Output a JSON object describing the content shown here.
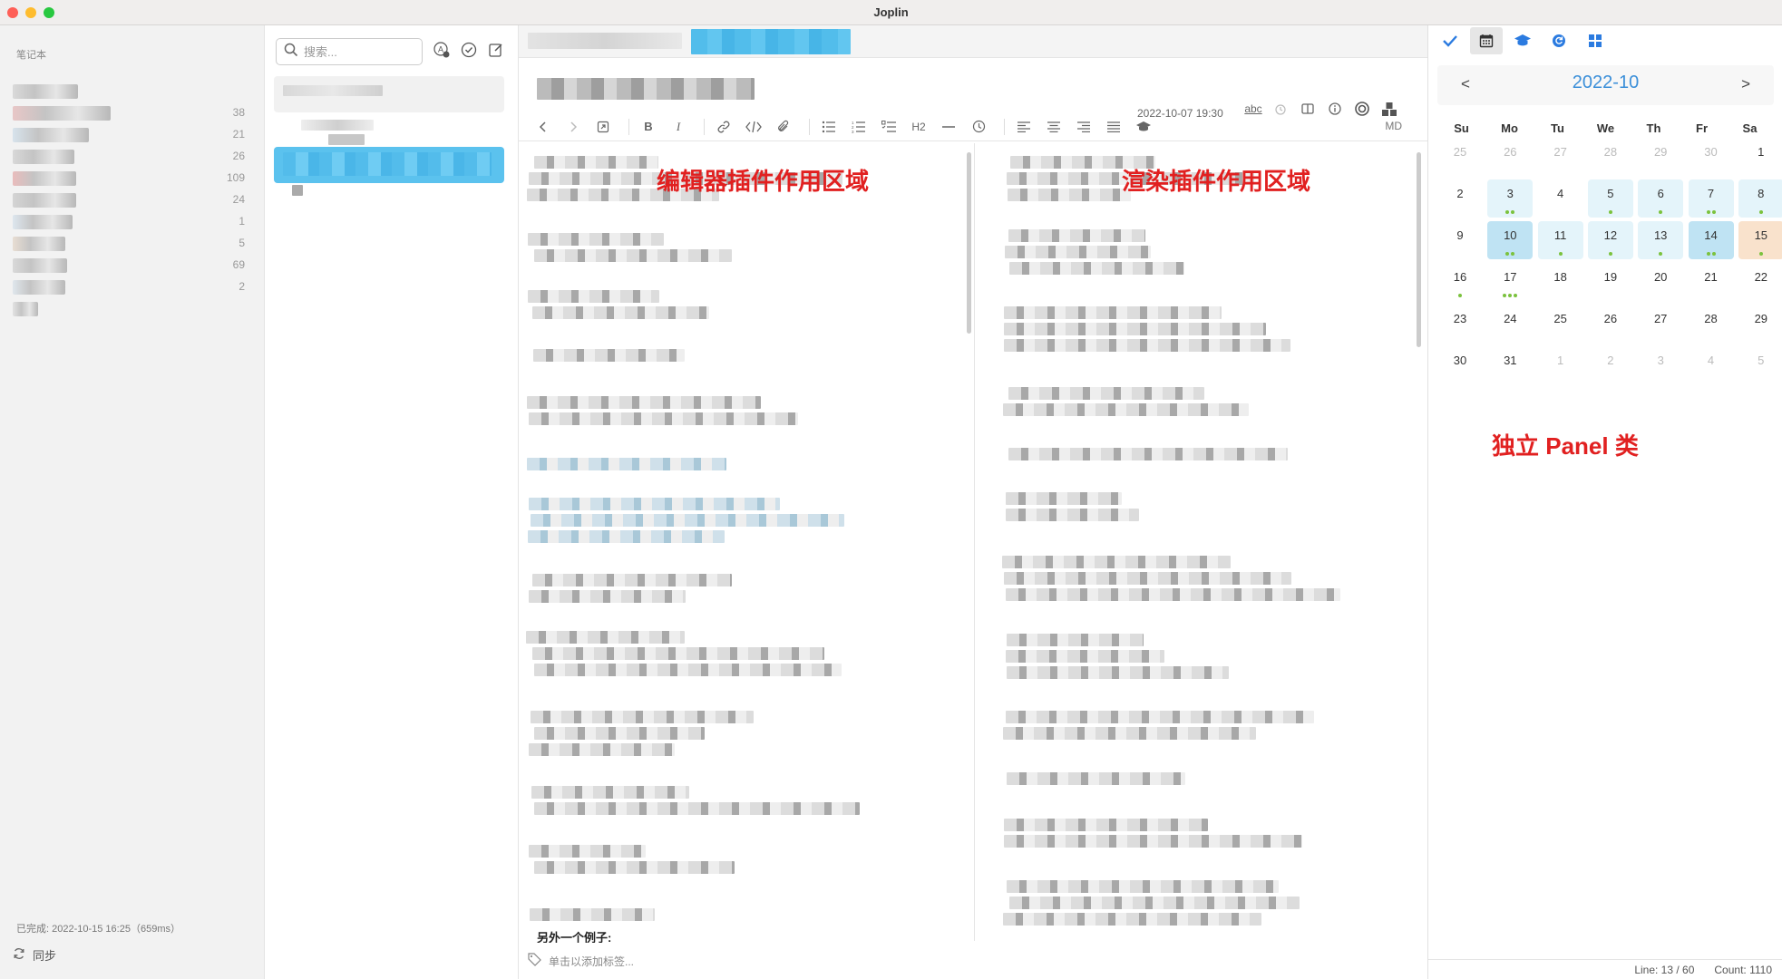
{
  "window": {
    "title": "Joplin"
  },
  "sidebar": {
    "header": "笔记本",
    "notebooks": [
      {
        "count": ""
      },
      {
        "count": "38"
      },
      {
        "count": "21"
      },
      {
        "count": "26"
      },
      {
        "count": "109"
      },
      {
        "count": "24"
      },
      {
        "count": "1"
      },
      {
        "count": "5"
      },
      {
        "count": "69"
      },
      {
        "count": "2"
      },
      {
        "count": ""
      }
    ],
    "status": "已完成: 2022-10-15 16:25（659ms）",
    "sync_label": "同步"
  },
  "notelist": {
    "search_placeholder": "搜索...",
    "buttons": [
      "toggle-sort-icon",
      "todo-icon",
      "new-note-icon"
    ]
  },
  "editor": {
    "date": "2022-10-07 19:30",
    "top_icons": [
      "abc",
      "alarm",
      "layout",
      "info",
      "target",
      "boxes"
    ],
    "toolbar_mode": "MD",
    "toolbar_items": [
      "back",
      "forward",
      "external",
      "B",
      "I",
      "link",
      "code",
      "attach",
      "ul",
      "ol",
      "checklist",
      "H2",
      "hr",
      "time",
      "align-left",
      "align-center",
      "align-right",
      "justify",
      "cap"
    ],
    "annotation_left": "编辑器插件作用区域",
    "annotation_right": "渲染插件作用区域",
    "snippet": "另外一个例子:",
    "tag_placeholder": "单击以添加标签..."
  },
  "panel": {
    "icons": [
      "check-icon",
      "calendar-icon",
      "graduation-cap-icon",
      "refresh-icon",
      "grid-icon"
    ],
    "calendar": {
      "title": "2022-10",
      "prev": "<",
      "next": ">",
      "weekdays": [
        "Su",
        "Mo",
        "Tu",
        "We",
        "Th",
        "Fr",
        "Sa"
      ],
      "weeks": [
        [
          {
            "d": "25",
            "o": true,
            "n": 0
          },
          {
            "d": "26",
            "o": true,
            "n": 0
          },
          {
            "d": "27",
            "o": true,
            "n": 0
          },
          {
            "d": "28",
            "o": true,
            "n": 0
          },
          {
            "d": "29",
            "o": true,
            "n": 0
          },
          {
            "d": "30",
            "o": true,
            "n": 0
          },
          {
            "d": "1",
            "n": 0
          }
        ],
        [
          {
            "d": "2",
            "n": 0
          },
          {
            "d": "3",
            "n": 2,
            "h": true
          },
          {
            "d": "4",
            "n": 0
          },
          {
            "d": "5",
            "n": 1,
            "h": true
          },
          {
            "d": "6",
            "n": 1,
            "h": true
          },
          {
            "d": "7",
            "n": 2,
            "h": true
          },
          {
            "d": "8",
            "n": 1,
            "h": true
          }
        ],
        [
          {
            "d": "9",
            "n": 0
          },
          {
            "d": "10",
            "n": 2,
            "s": true
          },
          {
            "d": "11",
            "n": 1,
            "h": true
          },
          {
            "d": "12",
            "n": 1,
            "h": true
          },
          {
            "d": "13",
            "n": 1,
            "h": true
          },
          {
            "d": "14",
            "n": 2,
            "s": true
          },
          {
            "d": "15",
            "n": 1,
            "t": true
          }
        ],
        [
          {
            "d": "16",
            "n": 1
          },
          {
            "d": "17",
            "n": 3
          },
          {
            "d": "18",
            "n": 0
          },
          {
            "d": "19",
            "n": 0
          },
          {
            "d": "20",
            "n": 0
          },
          {
            "d": "21",
            "n": 0
          },
          {
            "d": "22",
            "n": 0
          }
        ],
        [
          {
            "d": "23",
            "n": 0
          },
          {
            "d": "24",
            "n": 0
          },
          {
            "d": "25",
            "n": 0
          },
          {
            "d": "26",
            "n": 0
          },
          {
            "d": "27",
            "n": 0
          },
          {
            "d": "28",
            "n": 0
          },
          {
            "d": "29",
            "n": 0
          }
        ],
        [
          {
            "d": "30",
            "n": 0
          },
          {
            "d": "31",
            "n": 0
          },
          {
            "d": "1",
            "o": true,
            "n": 0
          },
          {
            "d": "2",
            "o": true,
            "n": 0
          },
          {
            "d": "3",
            "o": true,
            "n": 0
          },
          {
            "d": "4",
            "o": true,
            "n": 0
          },
          {
            "d": "5",
            "o": true,
            "n": 0
          }
        ]
      ]
    },
    "annotation": "独立 Panel 类",
    "status_line": "Line: 13 / 60",
    "status_count": "Count: 1110"
  },
  "colors": {
    "accent": "#3b8fd9",
    "selected_note": "#5bc2ee",
    "annotation": "#e12020",
    "dot": "#7bc23d"
  }
}
